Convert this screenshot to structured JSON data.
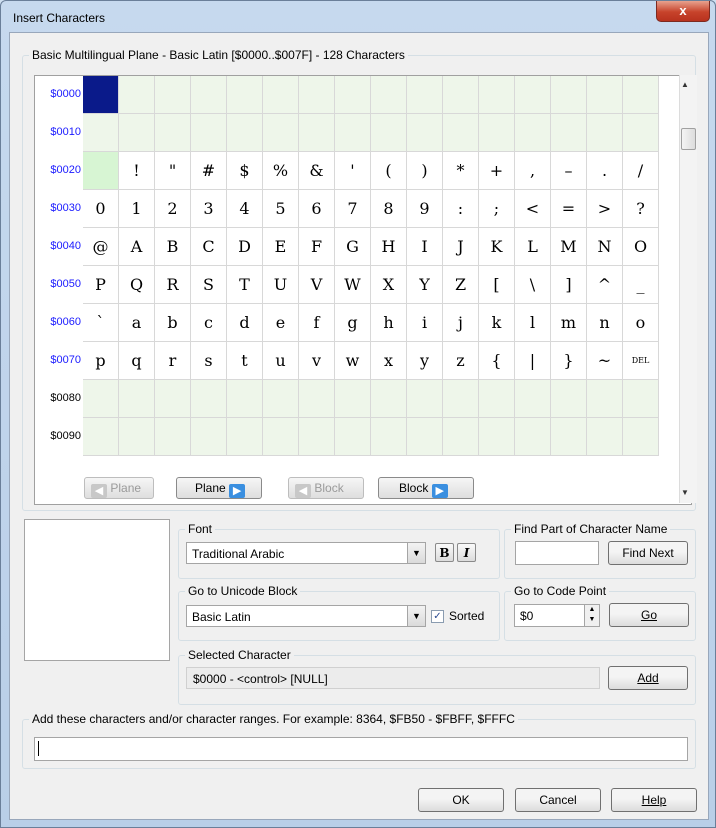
{
  "window": {
    "title": "Insert Characters",
    "close_glyph": "x"
  },
  "grid": {
    "header": "Basic Multilingual Plane - Basic Latin [$0000..$007F] - 128 Characters",
    "rows": [
      {
        "label": "$0000",
        "blue": true,
        "cells": [
          "",
          "",
          "",
          "",
          "",
          "",
          "",
          "",
          "",
          "",
          "",
          "",
          "",
          "",
          "",
          ""
        ]
      },
      {
        "label": "$0010",
        "blue": true,
        "cells": [
          "",
          "",
          "",
          "",
          "",
          "",
          "",
          "",
          "",
          "",
          "",
          "",
          "",
          "",
          "",
          ""
        ]
      },
      {
        "label": "$0020",
        "blue": true,
        "cells": [
          "",
          "!",
          "\"",
          "#",
          "$",
          "%",
          "&",
          "'",
          "(",
          ")",
          "*",
          "+",
          ",",
          "–",
          ".",
          "/"
        ]
      },
      {
        "label": "$0030",
        "blue": true,
        "cells": [
          "0",
          "1",
          "2",
          "3",
          "4",
          "5",
          "6",
          "7",
          "8",
          "9",
          ":",
          ";",
          "<",
          "=",
          ">",
          "?"
        ]
      },
      {
        "label": "$0040",
        "blue": true,
        "cells": [
          "@",
          "A",
          "B",
          "C",
          "D",
          "E",
          "F",
          "G",
          "H",
          "I",
          "J",
          "K",
          "L",
          "M",
          "N",
          "O"
        ]
      },
      {
        "label": "$0050",
        "blue": true,
        "cells": [
          "P",
          "Q",
          "R",
          "S",
          "T",
          "U",
          "V",
          "W",
          "X",
          "Y",
          "Z",
          "[",
          "\\",
          "]",
          "^",
          "_"
        ]
      },
      {
        "label": "$0060",
        "blue": true,
        "cells": [
          "`",
          "a",
          "b",
          "c",
          "d",
          "e",
          "f",
          "g",
          "h",
          "i",
          "j",
          "k",
          "l",
          "m",
          "n",
          "o"
        ]
      },
      {
        "label": "$0070",
        "blue": true,
        "cells": [
          "p",
          "q",
          "r",
          "s",
          "t",
          "u",
          "v",
          "w",
          "x",
          "y",
          "z",
          "{",
          "|",
          "}",
          "~",
          "DEL"
        ]
      },
      {
        "label": "$0080",
        "blue": false,
        "cells": [
          "",
          "",
          "",
          "",
          "",
          "",
          "",
          "",
          "",
          "",
          "",
          "",
          "",
          "",
          "",
          ""
        ]
      },
      {
        "label": "$0090",
        "blue": false,
        "cells": [
          "",
          "",
          "",
          "",
          "",
          "",
          "",
          "",
          "",
          "",
          "",
          "",
          "",
          "",
          "",
          ""
        ]
      }
    ]
  },
  "nav": {
    "plane_prev": "Plane",
    "plane_next": "Plane",
    "block_prev": "Block",
    "block_next": "Block"
  },
  "font_group": {
    "label": "Font",
    "value": "Traditional Arabic",
    "bold": "B",
    "italic": "I"
  },
  "find_group": {
    "label": "Find Part of Character Name",
    "value": "",
    "button": "Find Next"
  },
  "block_group": {
    "label": "Go to Unicode Block",
    "value": "Basic Latin",
    "sorted_label": "Sorted",
    "sorted_checked": "✓"
  },
  "codepoint_group": {
    "label": "Go to Code Point",
    "value": "$0",
    "button": "Go"
  },
  "selected_group": {
    "label": "Selected Character",
    "value": "$0000 - <control> [NULL]",
    "button": "Add"
  },
  "add_group": {
    "label": "Add these characters and/or character ranges. For example: 8364, $FB50 - $FBFF, $FFFC",
    "value": ""
  },
  "footer": {
    "ok": "OK",
    "cancel": "Cancel",
    "help": "Help"
  }
}
